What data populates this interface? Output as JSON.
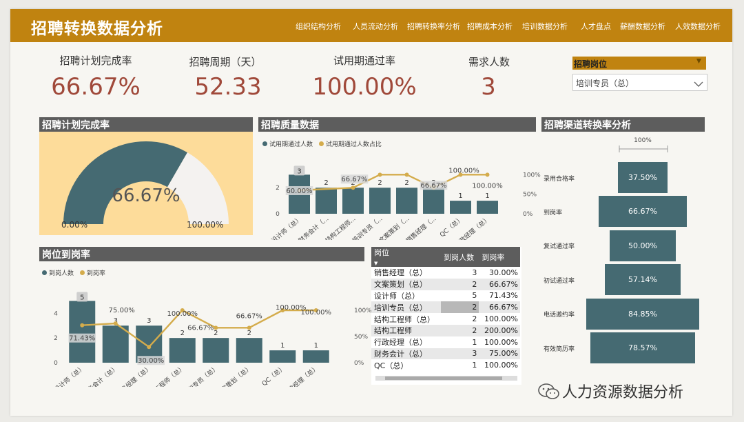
{
  "app": {
    "title": "招聘转换数据分析",
    "nav": [
      "组织结构分析",
      "人员流动分析",
      "招聘转换率分析",
      "招聘成本分析",
      "培训数据分析",
      "人才盘点",
      "薪酬数据分析",
      "人效数据分析"
    ]
  },
  "kpis": [
    {
      "label": "招聘计划完成率",
      "value": "66.67%"
    },
    {
      "label": "招聘周期（天）",
      "value": "52.33"
    },
    {
      "label": "试用期通过率",
      "value": "100.00%"
    },
    {
      "label": "需求人数",
      "value": "3"
    }
  ],
  "slicer": {
    "title": "招聘岗位",
    "selected": "培训专员（总）"
  },
  "colors": {
    "brand": "#c08310",
    "teal": "#456a72",
    "gold": "#d4ac4c",
    "gauge_bg": "#fddc9a",
    "kpi_value": "#a0493a",
    "header": "#5d5d5d"
  },
  "gauge": {
    "title": "招聘计划完成率",
    "value_fraction": 0.6667,
    "value_label": "66.67%",
    "min_label": "0.00%",
    "max_label": "100.00%"
  },
  "quality": {
    "title": "招聘质量数据",
    "legend": [
      "试用期通过人数",
      "试用期通过人数占比"
    ]
  },
  "arrival": {
    "title": "岗位到岗率",
    "legend": [
      "到岗人数",
      "到岗率"
    ]
  },
  "funnel": {
    "title": "招聘渠道转换率分析",
    "top_label": "100%"
  },
  "table": {
    "headers": [
      "岗位",
      "到岗人数",
      "到岗率"
    ],
    "rows": [
      [
        "销售经理（总）",
        "3",
        "30.00%"
      ],
      [
        "文案策划（总）",
        "2",
        "66.67%"
      ],
      [
        "设计师（总）",
        "5",
        "71.43%"
      ],
      [
        "培训专员（总）",
        "2",
        "66.67%"
      ],
      [
        "结构工程师（总）",
        "2",
        "100.00%"
      ],
      [
        "结构工程师",
        "2",
        "200.00%"
      ],
      [
        "行政经理（总）",
        "1",
        "100.00%"
      ],
      [
        "财务会计（总）",
        "3",
        "75.00%"
      ],
      [
        "QC（总）",
        "1",
        "100.00%"
      ]
    ]
  },
  "watermark": "人力资源数据分析",
  "chart_data": [
    {
      "type": "bar",
      "title": "招聘质量数据",
      "categories": [
        "设计师（总）",
        "财务会计（...",
        "结构工程师...",
        "培训专员（...",
        "文案策划（...",
        "销售经理（...",
        "QC（总）",
        "行政经理（总）"
      ],
      "series": [
        {
          "name": "试用期通过人数",
          "values": [
            3,
            2,
            2,
            2,
            2,
            2,
            1,
            1
          ]
        },
        {
          "name": "试用期通过人数占比",
          "values": [
            0.6,
            null,
            0.6667,
            1.0,
            1.0,
            0.6667,
            1.0,
            1.0
          ]
        }
      ],
      "bar_labels": [
        "3",
        "2",
        "2",
        "2",
        "2",
        "2",
        "1",
        "1"
      ],
      "line_labels": [
        "60.00%",
        "",
        "66.67%",
        "",
        "",
        "66.67%",
        "100.00%",
        "100.00%"
      ],
      "y_ticks": [
        "0",
        "2"
      ],
      "y2_ticks": [
        "0%",
        "50%",
        "100%"
      ],
      "ylim": [
        0,
        3.6
      ],
      "y2lim": [
        0,
        1.2
      ]
    },
    {
      "type": "bar",
      "title": "岗位到岗率",
      "categories": [
        "设计师（总）",
        "财务会计（总）",
        "销售经理（总）",
        "结构工程师（总）",
        "培训专员（总）",
        "文案策划（总）",
        "QC（总）",
        "行政经理（总）"
      ],
      "series": [
        {
          "name": "到岗人数",
          "values": [
            5,
            3,
            3,
            2,
            2,
            2,
            1,
            1
          ]
        },
        {
          "name": "到岗率",
          "values": [
            0.7143,
            0.75,
            0.3,
            1.0,
            0.6667,
            0.6667,
            1.0,
            1.0
          ]
        }
      ],
      "bar_labels": [
        "5",
        "3",
        "3",
        "2",
        "2",
        "2",
        "1",
        "1"
      ],
      "line_labels": [
        "71.43%",
        "75.00%",
        "30.00%",
        "100.00%",
        "66.67%",
        "66.67%",
        "100.00%",
        "100.00%"
      ],
      "y_ticks": [
        "0",
        "2",
        "4"
      ],
      "y2_ticks": [
        "0%",
        "50%",
        "100%"
      ],
      "ylim": [
        0,
        5.3
      ],
      "y2lim": [
        0,
        1.25
      ]
    },
    {
      "type": "bar",
      "title": "招聘渠道转换率分析",
      "categories": [
        "录用合格率",
        "到岗率",
        "复试通过率",
        "初试通过率",
        "电话邀约率",
        "有效简历率"
      ],
      "values": [
        0.375,
        0.6667,
        0.5,
        0.5714,
        0.8485,
        0.7857
      ],
      "labels": [
        "37.50%",
        "66.67%",
        "50.00%",
        "57.14%",
        "84.85%",
        "78.57%"
      ]
    }
  ]
}
